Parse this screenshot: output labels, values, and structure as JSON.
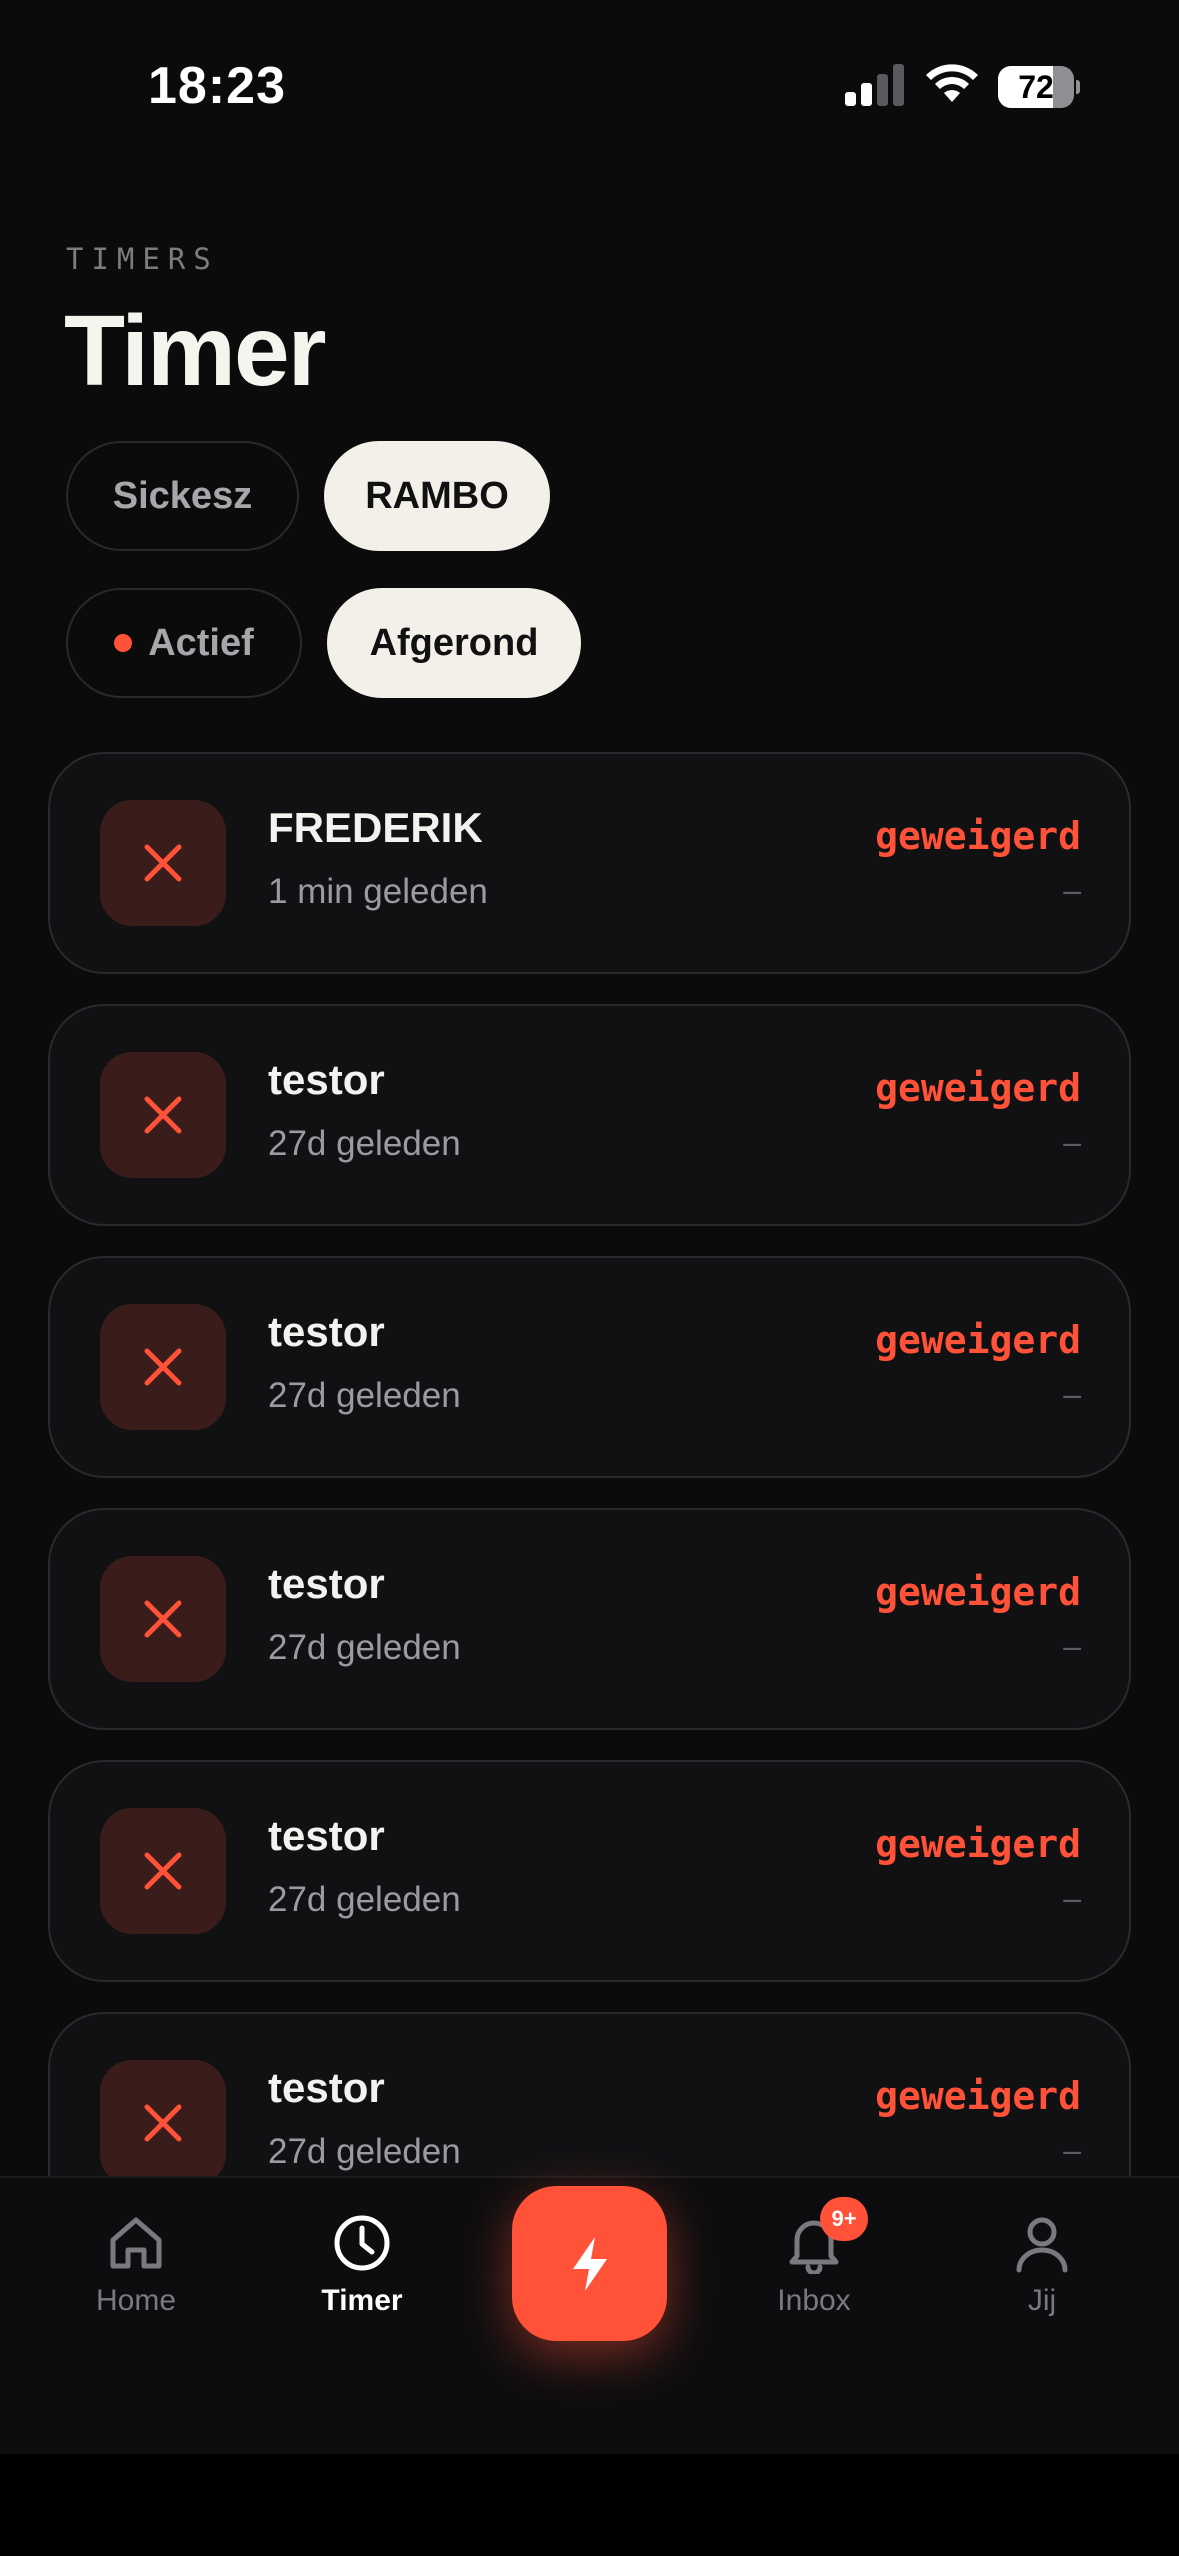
{
  "status_bar": {
    "time": "18:23",
    "battery": "72",
    "battery_level": 0.72
  },
  "header": {
    "eyebrow": "TIMERS",
    "title": "Timer"
  },
  "filters": {
    "people": [
      {
        "label": "Sickesz",
        "selected": false
      },
      {
        "label": "RAMBO",
        "selected": true
      }
    ],
    "state": [
      {
        "label": "Actief",
        "selected": false
      },
      {
        "label": "Afgerond",
        "selected": true
      }
    ]
  },
  "timers": [
    {
      "name": "FREDERIK",
      "time": "1 min geleden",
      "status": "geweigerd",
      "detail": "–"
    },
    {
      "name": "testor",
      "time": "27d geleden",
      "status": "geweigerd",
      "detail": "–"
    },
    {
      "name": "testor",
      "time": "27d geleden",
      "status": "geweigerd",
      "detail": "–"
    },
    {
      "name": "testor",
      "time": "27d geleden",
      "status": "geweigerd",
      "detail": "–"
    },
    {
      "name": "testor",
      "time": "27d geleden",
      "status": "geweigerd",
      "detail": "–"
    },
    {
      "name": "testor",
      "time": "27d geleden",
      "status": "geweigerd",
      "detail": "–"
    }
  ],
  "tab_bar": {
    "tabs": [
      {
        "label": "Home",
        "icon": "home-icon",
        "active": false
      },
      {
        "label": "Timer",
        "icon": "clock-icon",
        "active": true
      },
      {
        "label": "Inbox",
        "icon": "bell-icon",
        "active": false
      },
      {
        "label": "Jij",
        "icon": "person-icon",
        "active": false
      }
    ],
    "fab_icon": "lightning-icon",
    "inbox_badge": "9+"
  },
  "colors": {
    "accent": "#ff5238",
    "background": "#0b0b0c",
    "card": "#111114",
    "chip_selected": "#f3f0ea"
  }
}
